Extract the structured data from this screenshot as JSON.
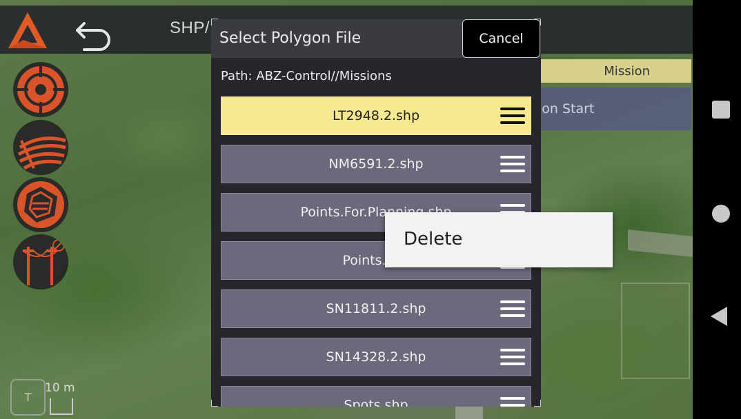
{
  "app": {
    "title_partial": "SHP/"
  },
  "left_tools": [
    {
      "name": "target-icon"
    },
    {
      "name": "field-rows-icon"
    },
    {
      "name": "polygon-layers-icon"
    },
    {
      "name": "power-lines-icon"
    }
  ],
  "mission_panel": {
    "tab_label": "Mission",
    "start_label_partial": "ion Start"
  },
  "map_scale": {
    "toggle_label": "T",
    "scale_text": "10 m"
  },
  "dialog": {
    "title": "Select Polygon File",
    "cancel_label": "Cancel",
    "path": "Path: ABZ-Control//Missions",
    "files": [
      {
        "name": "LT2948.2.shp",
        "selected": true
      },
      {
        "name": "NM6591.2.shp",
        "selected": false
      },
      {
        "name": "Points.For.Planning.shp",
        "selected": false
      },
      {
        "name": "Points.shp",
        "selected": false
      },
      {
        "name": "SN11811.2.shp",
        "selected": false
      },
      {
        "name": "SN14328.2.shp",
        "selected": false
      },
      {
        "name": "Spots.shp",
        "selected": false
      }
    ]
  },
  "context_menu": {
    "items": [
      {
        "label": "Delete"
      }
    ]
  },
  "colors": {
    "accent_orange": "#d9542a",
    "selected_row": "#f7e98f",
    "row_bg": "#6a6a7c",
    "mission_tab": "#d8d18d",
    "mission_start": "#585c7d"
  },
  "android_nav": [
    "recents-button",
    "home-button",
    "back-button"
  ]
}
